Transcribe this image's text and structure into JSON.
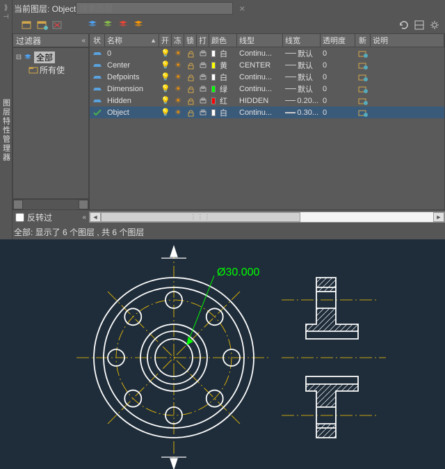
{
  "title": "当前图层: Object",
  "search_placeholder": "搜索图层",
  "filter": {
    "label": "过滤器",
    "root": "全部",
    "child": "所有使",
    "invert": "反转过"
  },
  "columns": {
    "status": "状",
    "name": "名称",
    "on": "开",
    "freeze": "冻",
    "lock": "锁",
    "plot": "打",
    "color": "颜色",
    "linetype": "线型",
    "lineweight": "线宽",
    "trans": "透明度",
    "new": "新",
    "desc": "说明"
  },
  "layers": [
    {
      "status": "layer",
      "name": "0",
      "color_name": "白",
      "swatch": "#ffffff",
      "linetype": "Continu...",
      "lw_text": "默认",
      "lw_style": "thin",
      "trans": "0"
    },
    {
      "status": "layer",
      "name": "Center",
      "color_name": "黄",
      "swatch": "#ffff00",
      "linetype": "CENTER",
      "lw_text": "默认",
      "lw_style": "thin",
      "trans": "0"
    },
    {
      "status": "layer",
      "name": "Defpoints",
      "color_name": "白",
      "swatch": "#ffffff",
      "linetype": "Continu...",
      "lw_text": "默认",
      "lw_style": "thin",
      "trans": "0"
    },
    {
      "status": "layer",
      "name": "Dimension",
      "color_name": "绿",
      "swatch": "#00ff00",
      "linetype": "Continu...",
      "lw_text": "默认",
      "lw_style": "thin",
      "trans": "0"
    },
    {
      "status": "layer",
      "name": "Hidden",
      "color_name": "红",
      "swatch": "#ff0000",
      "linetype": "HIDDEN",
      "lw_text": "0.20...",
      "lw_style": "thin",
      "trans": "0"
    },
    {
      "status": "current",
      "name": "Object",
      "color_name": "白",
      "swatch": "#ffffff",
      "linetype": "Continu...",
      "lw_text": "0.30...",
      "lw_style": "thick",
      "trans": "0",
      "selected": true
    }
  ],
  "status_text": "全部: 显示了 6 个图层 , 共 6 个图层",
  "sidebar_label": "图层特性管理器",
  "dimension_text": "Ø30.000"
}
